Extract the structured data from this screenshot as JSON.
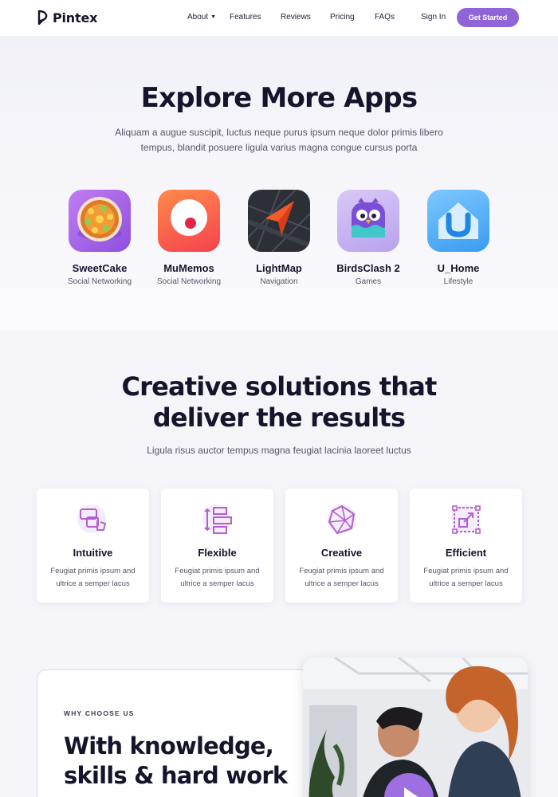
{
  "brand": {
    "name": "Pintex"
  },
  "nav": {
    "items": [
      "About",
      "Features",
      "Reviews",
      "Pricing",
      "FAQs"
    ],
    "signin": "Sign In",
    "cta": "Get Started"
  },
  "explore": {
    "title": "Explore More Apps",
    "lead": "Aliquam a augue suscipit, luctus neque purus ipsum neque dolor primis libero tempus, blandit posuere ligula varius magna congue cursus porta",
    "apps": [
      {
        "name": "SweetCake",
        "category": "Social Networking",
        "icon": "cake-icon"
      },
      {
        "name": "MuMemos",
        "category": "Social Networking",
        "icon": "record-icon"
      },
      {
        "name": "LightMap",
        "category": "Navigation",
        "icon": "navigation-arrow-icon"
      },
      {
        "name": "BirdsClash 2",
        "category": "Games",
        "icon": "bird-icon"
      },
      {
        "name": "U_Home",
        "category": "Lifestyle",
        "icon": "home-icon"
      }
    ]
  },
  "solutions": {
    "title_line1": "Creative solutions that",
    "title_line2": "deliver the results",
    "subtitle": "Ligula risus auctor tempus magna feugiat lacinia laoreet luctus",
    "cards": [
      {
        "title": "Intuitive",
        "text": "Feugiat primis ipsum and ultrice a semper lacus",
        "icon": "touch-screen-icon"
      },
      {
        "title": "Flexible",
        "text": "Feugiat primis ipsum and ultrice a semper lacus",
        "icon": "arrange-blocks-icon"
      },
      {
        "title": "Creative",
        "text": "Feugiat primis ipsum and ultrice a semper lacus",
        "icon": "polyhedron-icon"
      },
      {
        "title": "Efficient",
        "text": "Feugiat primis ipsum and ultrice a semper lacus",
        "icon": "scale-arrows-icon"
      }
    ]
  },
  "why": {
    "eyebrow": "WHY CHOOSE US",
    "title_line1": "With knowledge,",
    "title_line2": "skills & hard work"
  },
  "colors": {
    "accent": "#8f64d9",
    "icon_purple": "#b45fd0",
    "text_dark": "#14142b",
    "text_muted": "#55556a"
  }
}
